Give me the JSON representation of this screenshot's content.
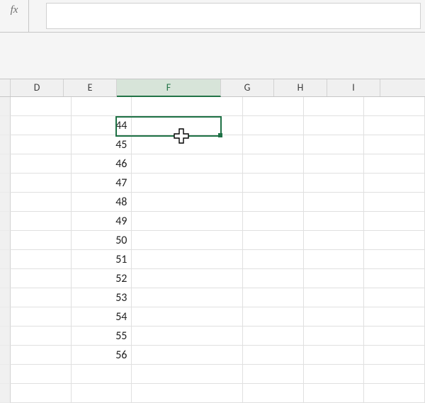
{
  "formula_bar": {
    "fx": "fx",
    "value": ""
  },
  "columns": {
    "D": "D",
    "E": "E",
    "F": "F",
    "G": "G",
    "H": "H",
    "I": "I"
  },
  "cells": {
    "E2": "44",
    "E3": "45",
    "E4": "46",
    "E5": "47",
    "E6": "48",
    "E7": "49",
    "E8": "50",
    "E9": "51",
    "E10": "52",
    "E11": "53",
    "E12": "54",
    "E13": "55",
    "E14": "56"
  },
  "selection": {
    "cell": "F2",
    "column": "F"
  }
}
